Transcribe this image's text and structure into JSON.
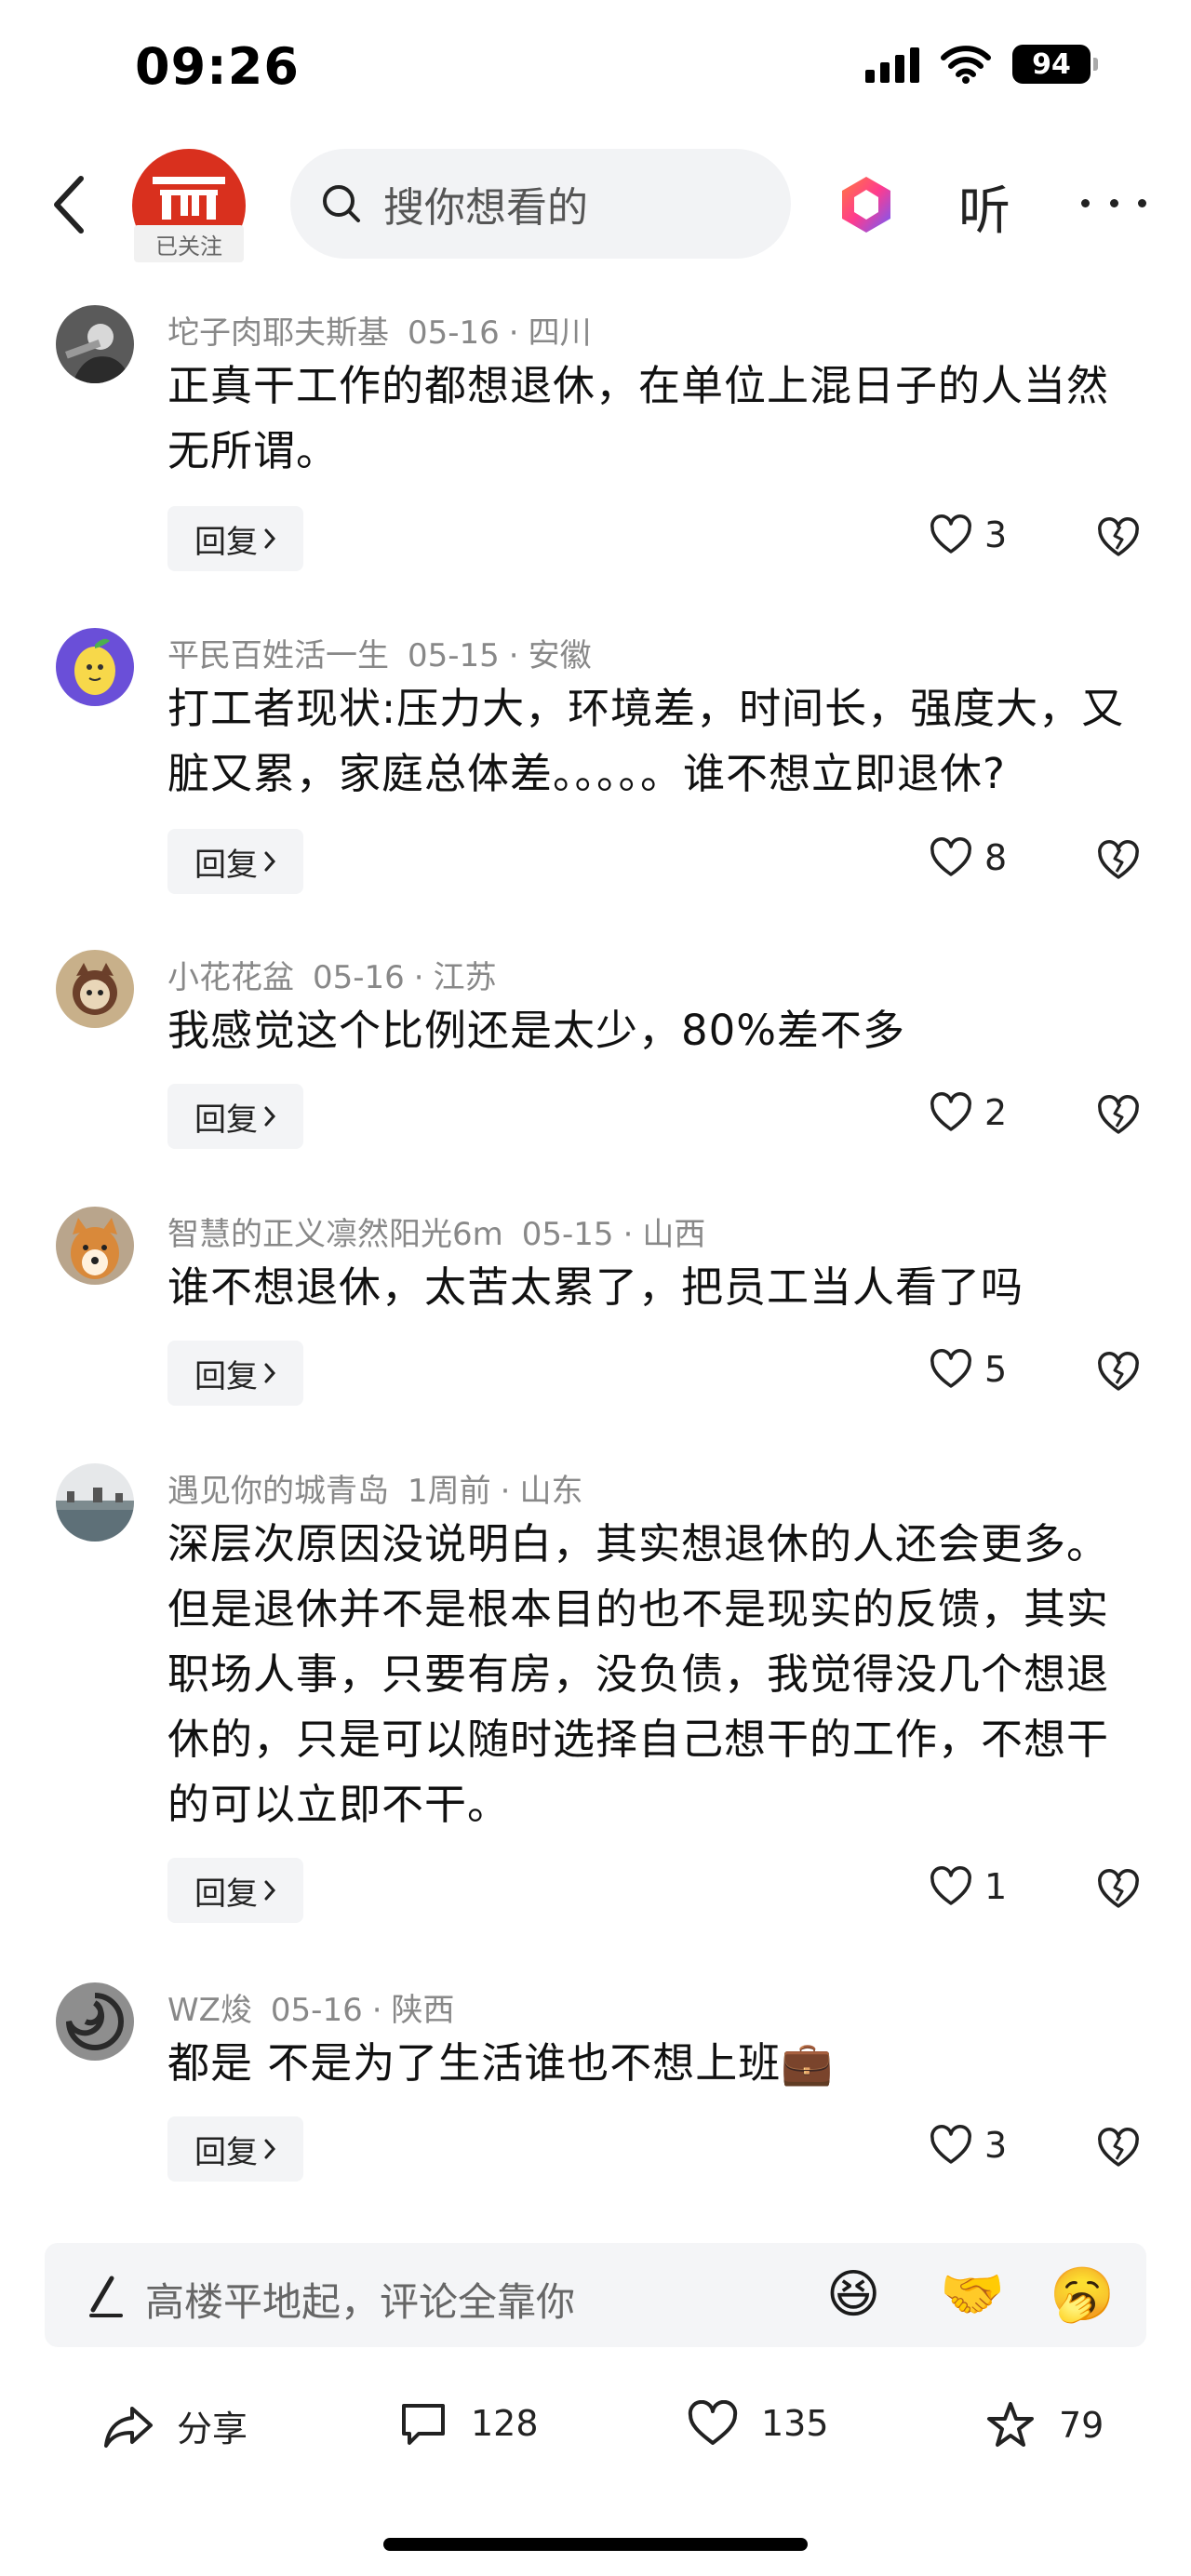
{
  "status_bar": {
    "time": "09:26",
    "battery": "94"
  },
  "header": {
    "channel_followed_label": "已关注",
    "search_placeholder": "搜你想看的",
    "listen_label": "听"
  },
  "comments": [
    {
      "author": "坨子肉耶夫斯基",
      "date": "05-16",
      "location": "四川",
      "text": "正真干工作的都想退休，在单位上混日子的人当然无所谓。",
      "likes": "3",
      "reply_label": "回复"
    },
    {
      "author": "平民百姓活一生",
      "date": "05-15",
      "location": "安徽",
      "text": "打工者现状:压力大，环境差，时间长，强度大，又脏又累，家庭总体差。。。。。谁不想立即退休?",
      "likes": "8",
      "reply_label": "回复"
    },
    {
      "author": "小花花盆",
      "date": "05-16",
      "location": "江苏",
      "text": "我感觉这个比例还是太少，80%差不多",
      "likes": "2",
      "reply_label": "回复"
    },
    {
      "author": "智慧的正义凛然阳光6m",
      "date": "05-15",
      "location": "山西",
      "text": "谁不想退休，太苦太累了，把员工当人看了吗",
      "likes": "5",
      "reply_label": "回复"
    },
    {
      "author": "遇见你的城青岛",
      "date": "1周前",
      "location": "山东",
      "text": "深层次原因没说明白，其实想退休的人还会更多。但是退休并不是根本目的也不是现实的反馈，其实职场人事，只要有房，没负债，我觉得没几个想退休的，只是可以随时选择自己想干的工作，不想干的可以立即不干。",
      "likes": "1",
      "reply_label": "回复"
    },
    {
      "author": "WZ焌",
      "date": "05-16",
      "location": "陕西",
      "text": "都是 不是为了生活谁也不想上班💼",
      "likes": "3",
      "reply_label": "回复"
    }
  ],
  "comment_bar": {
    "placeholder": "高楼平地起，评论全靠你",
    "emojis": [
      "😆",
      "🤝",
      "🥱"
    ]
  },
  "action_bar": {
    "share_label": "分享",
    "comment_count": "128",
    "like_count": "135",
    "favorite_count": "79"
  }
}
